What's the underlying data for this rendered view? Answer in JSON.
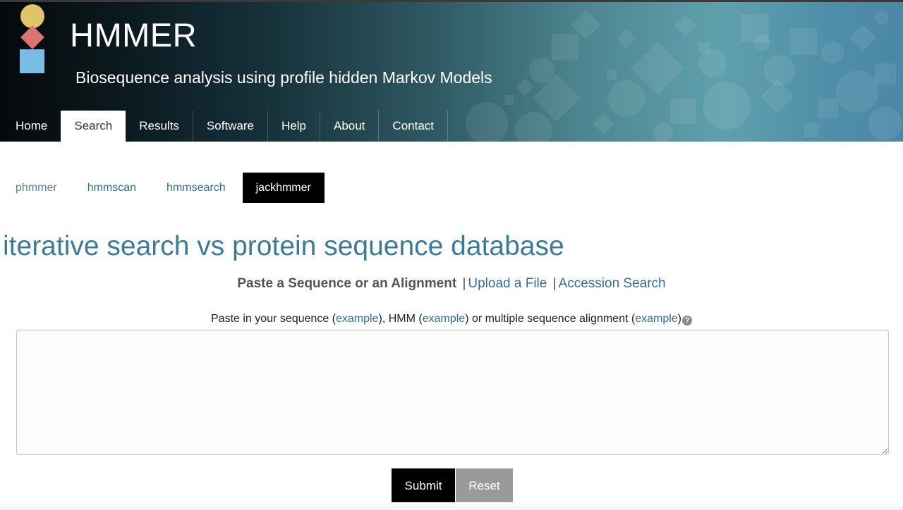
{
  "site": {
    "title": "HMMER",
    "subtitle": "Biosequence analysis using profile hidden Markov Models"
  },
  "nav": {
    "items": [
      {
        "label": "Home"
      },
      {
        "label": "Search"
      },
      {
        "label": "Results"
      },
      {
        "label": "Software"
      },
      {
        "label": "Help"
      },
      {
        "label": "About"
      },
      {
        "label": "Contact"
      }
    ],
    "active": "Search"
  },
  "subtabs": {
    "items": [
      {
        "label": "phmmer"
      },
      {
        "label": "hmmscan"
      },
      {
        "label": "hmmsearch"
      },
      {
        "label": "jackhmmer"
      }
    ],
    "active": "jackhmmer"
  },
  "page": {
    "heading": "iterative search vs protein sequence database"
  },
  "input_mode": {
    "current": "Paste a Sequence or an Alignment",
    "separator": "|",
    "upload": "Upload a File",
    "accession": "Accession Search"
  },
  "paste": {
    "part1": "Paste in your sequence (",
    "link1": "example",
    "part2": "), HMM (",
    "link2": "example",
    "part3": ") or multiple sequence alignment (",
    "link3": "example",
    "part4": ")",
    "help_icon": "?",
    "value": ""
  },
  "buttons": {
    "submit": "Submit",
    "reset": "Reset"
  },
  "colors": {
    "accent": "#3b7a99",
    "link": "#2f6f9e",
    "logo_circle": "#e0c36a",
    "logo_diamond": "#d9746e",
    "logo_square": "#79bde6"
  },
  "icons": {
    "logo": "hmmer-logo-icon",
    "help": "question-circle-icon",
    "resize": "resize-grip-icon"
  }
}
